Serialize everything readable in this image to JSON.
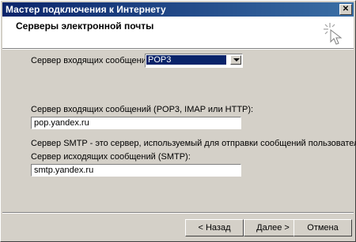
{
  "window": {
    "title": "Мастер подключения к Интернету",
    "close_glyph": "✕"
  },
  "header": {
    "title": "Серверы электронной почты"
  },
  "form": {
    "incoming_type_label": "Сервер входящих сообщений:",
    "incoming_type_value": "POP3",
    "incoming_server_label": "Сервер входящих сообщений (POP3, IMAP или HTTP):",
    "incoming_server_value": "pop.yandex.ru",
    "smtp_note": "Сервер SMTP - это сервер, используемый для отправки сообщений  пользователя.",
    "outgoing_server_label": "Сервер исходящих сообщений (SMTP):",
    "outgoing_server_value": "smtp.yandex.ru"
  },
  "buttons": {
    "back": "< Назад",
    "next": "Далее >",
    "cancel": "Отмена"
  }
}
